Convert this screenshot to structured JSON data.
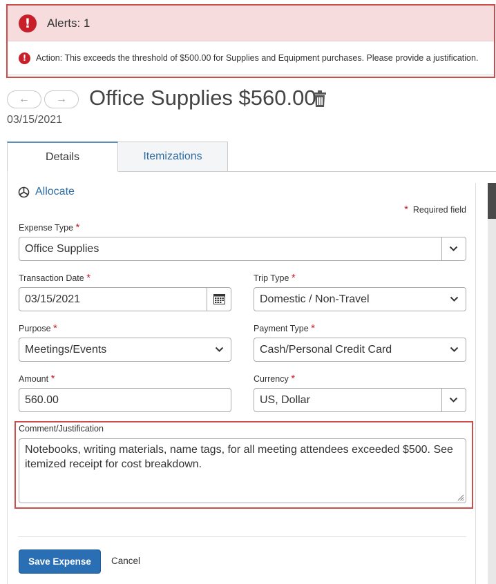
{
  "alerts": {
    "title": "Alerts: 1",
    "message": "Action: This exceeds the threshold of $500.00 for Supplies and Equipment purchases. Please provide a justification.",
    "alert_icon": "exclamation-circle-icon",
    "color": "#c8202a"
  },
  "header": {
    "prev_icon": "←",
    "next_icon": "→",
    "title": "Office Supplies $560.00",
    "date": "03/15/2021"
  },
  "tabs": [
    {
      "label": "Details",
      "active": true
    },
    {
      "label": "Itemizations",
      "active": false
    }
  ],
  "form": {
    "allocate_label": "Allocate",
    "required_note": "Required field",
    "expense_type": {
      "label": "Expense Type",
      "value": "Office Supplies"
    },
    "transaction_date": {
      "label": "Transaction Date",
      "value": "03/15/2021"
    },
    "trip_type": {
      "label": "Trip Type",
      "value": "Domestic / Non-Travel"
    },
    "purpose": {
      "label": "Purpose",
      "value": "Meetings/Events"
    },
    "payment_type": {
      "label": "Payment Type",
      "value": "Cash/Personal Credit Card"
    },
    "amount": {
      "label": "Amount",
      "value": "560.00"
    },
    "currency": {
      "label": "Currency",
      "value": "US, Dollar"
    },
    "comment": {
      "label": "Comment/Justification",
      "value": "Notebooks, writing materials, name tags, for all meeting attendees exceeded $500. See itemized receipt for cost breakdown."
    }
  },
  "actions": {
    "save_label": "Save Expense",
    "cancel_label": "Cancel"
  },
  "colors": {
    "accent": "#2a6fb4",
    "link": "#2e6da4",
    "alert_bg": "#f6dcdd",
    "highlight_border": "#cc4b4b"
  }
}
